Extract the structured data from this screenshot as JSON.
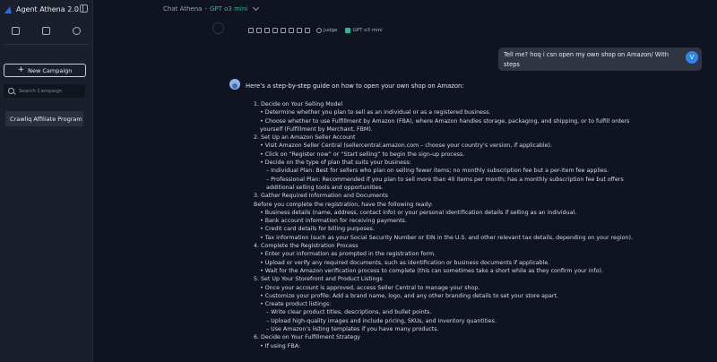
{
  "sidebar": {
    "app_title": "Agent Athena 2.0",
    "new_campaign_label": "New Campaign",
    "search_placeholder": "Search Campaign",
    "campaigns": [
      "Crawliq Affiliate Program"
    ]
  },
  "header": {
    "chat_title": "Chat Athena",
    "separator": "-",
    "model_name": "GPT o3 mini"
  },
  "toolbar": {
    "judge_label": "Judge",
    "model_label": "GPT o3 mini"
  },
  "user_message": {
    "text": "Tell me? hoq i csn open my own shop on Amazon/ With steps",
    "avatar_initial": "V"
  },
  "assistant": {
    "intro": "Here’s a step-by-step guide on how to open your own shop on Amazon:",
    "lines": [
      "1.  Decide on Your Selling Model",
      "• Determine whether you plan to sell as an individual or as a registered business.",
      "• Choose whether to use Fulfillment by Amazon (FBA), where Amazon handles storage, packaging, and shipping, or to fulfill orders yourself (Fulfillment by Merchant, FBM).",
      "2.  Set Up an Amazon Seller Account",
      "• Visit Amazon Seller Central (sellercentral.amazon.com – choose your country’s version, if applicable).",
      "• Click on “Register now” or “Start selling” to begin the sign-up process.",
      "• Decide on the type of plan that suits your business:",
      "– Individual Plan: Best for sellers who plan on selling fewer items; no monthly subscription fee but a per-item fee applies.",
      "– Professional Plan: Recommended if you plan to sell more than 40 items per month; has a monthly subscription fee but offers additional selling tools and opportunities.",
      "3.  Gather Required Information and Documents",
      "Before you complete the registration, have the following ready:",
      "• Business details (name, address, contact info) or your personal identification details if selling as an individual.",
      "• Bank account information for receiving payments.",
      "• Credit card details for billing purposes.",
      "• Tax information (such as your Social Security Number or EIN in the U.S. and other relevant tax details, depending on your region).",
      "4.  Complete the Registration Process",
      "• Enter your information as prompted in the registration form.",
      "• Upload or verify any required documents, such as identification or business documents if applicable.",
      "• Wait for the Amazon verification process to complete (this can sometimes take a short while as they confirm your info).",
      "5.  Set Up Your Storefront and Product Listings",
      "• Once your account is approved, access Seller Central to manage your shop.",
      "• Customize your profile: Add a brand name, logo, and any other branding details to set your store apart.",
      "• Create product listings:",
      "– Write clear product titles, descriptions, and bullet points.",
      "– Upload high-quality images and include pricing, SKUs, and inventory quantities.",
      "– Use Amazon’s listing templates if you have many products.",
      "6.  Decide on Your Fulfillment Strategy",
      "• If using FBA:"
    ]
  }
}
